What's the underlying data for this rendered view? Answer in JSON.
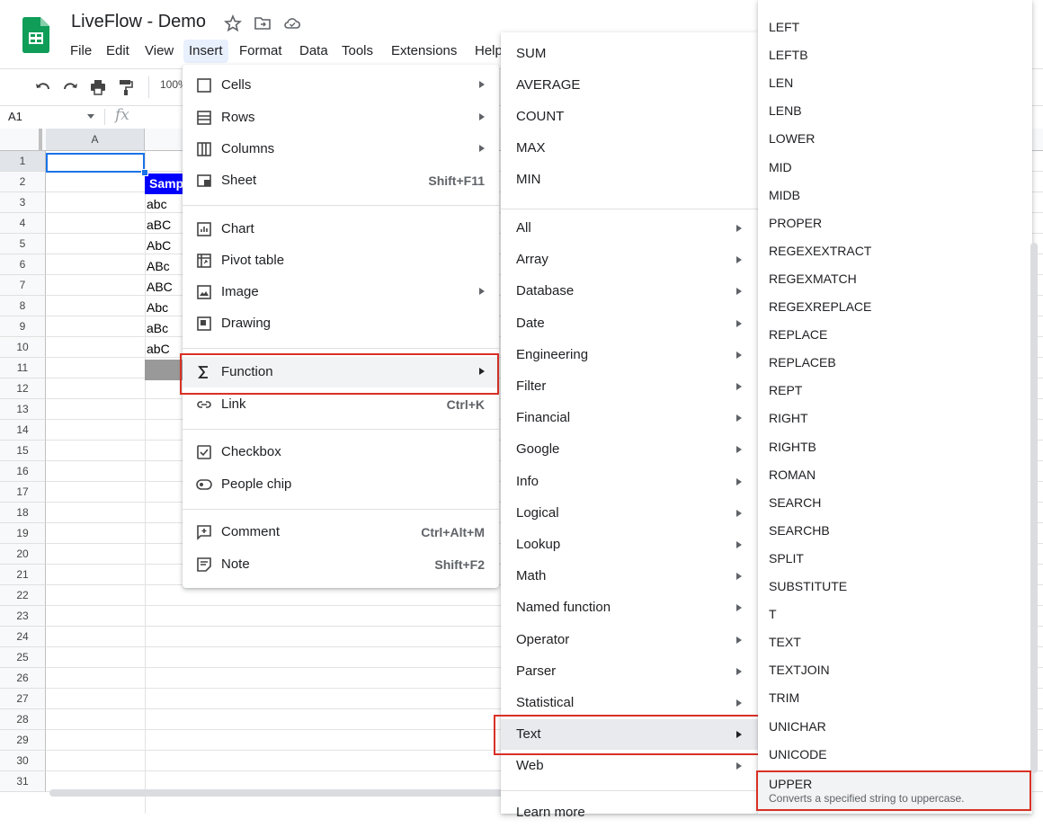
{
  "app": {
    "title": "LiveFlow - Demo",
    "brand_color": "#0f9d58"
  },
  "menubar": {
    "items": [
      "File",
      "Edit",
      "View",
      "Insert",
      "Format",
      "Data",
      "Tools",
      "Extensions",
      "Help"
    ],
    "active": "Insert"
  },
  "toolbar": {
    "zoom": "100%"
  },
  "formula_bar": {
    "name_box": "A1",
    "fx_label": "fx"
  },
  "sheet": {
    "columns": [
      "A"
    ],
    "rows": [
      "1",
      "2",
      "3",
      "4",
      "5",
      "6",
      "7",
      "8",
      "9",
      "10",
      "11",
      "12",
      "13",
      "14",
      "15",
      "16",
      "17",
      "18",
      "19",
      "20",
      "21",
      "22",
      "23",
      "24",
      "25",
      "26",
      "27",
      "28",
      "29",
      "30",
      "31"
    ],
    "selected_cell": "A1",
    "header_cell": "Sample",
    "header_bg": "#0000ff",
    "column_b_values": [
      "abc",
      "aBC",
      "AbC",
      "ABc",
      "ABC",
      "Abc",
      "aBc",
      "abC"
    ]
  },
  "insert_menu": {
    "cells": "Cells",
    "rows": "Rows",
    "columns": "Columns",
    "sheet": "Sheet",
    "sheet_shortcut": "Shift+F11",
    "chart": "Chart",
    "pivot_table": "Pivot table",
    "image": "Image",
    "drawing": "Drawing",
    "function": "Function",
    "link": "Link",
    "link_shortcut": "Ctrl+K",
    "checkbox": "Checkbox",
    "people_chip": "People chip",
    "comment": "Comment",
    "comment_shortcut": "Ctrl+Alt+M",
    "note": "Note",
    "note_shortcut": "Shift+F2"
  },
  "function_menu": {
    "quick": [
      "SUM",
      "AVERAGE",
      "COUNT",
      "MAX",
      "MIN"
    ],
    "categories": [
      "All",
      "Array",
      "Database",
      "Date",
      "Engineering",
      "Filter",
      "Financial",
      "Google",
      "Info",
      "Logical",
      "Lookup",
      "Math",
      "Named function",
      "Operator",
      "Parser",
      "Statistical",
      "Text",
      "Web"
    ],
    "highlighted": "Text",
    "learn_more": "Learn more"
  },
  "text_menu": {
    "items": [
      "LEFT",
      "LEFTB",
      "LEN",
      "LENB",
      "LOWER",
      "MID",
      "MIDB",
      "PROPER",
      "REGEXEXTRACT",
      "REGEXMATCH",
      "REGEXREPLACE",
      "REPLACE",
      "REPLACEB",
      "REPT",
      "RIGHT",
      "RIGHTB",
      "ROMAN",
      "SEARCH",
      "SEARCHB",
      "SPLIT",
      "SUBSTITUTE",
      "T",
      "TEXT",
      "TEXTJOIN",
      "TRIM",
      "UNICHAR",
      "UNICODE"
    ],
    "hovered": "UPPER",
    "hovered_description": "Converts a specified string to uppercase."
  },
  "highlight_color": "#d93025"
}
